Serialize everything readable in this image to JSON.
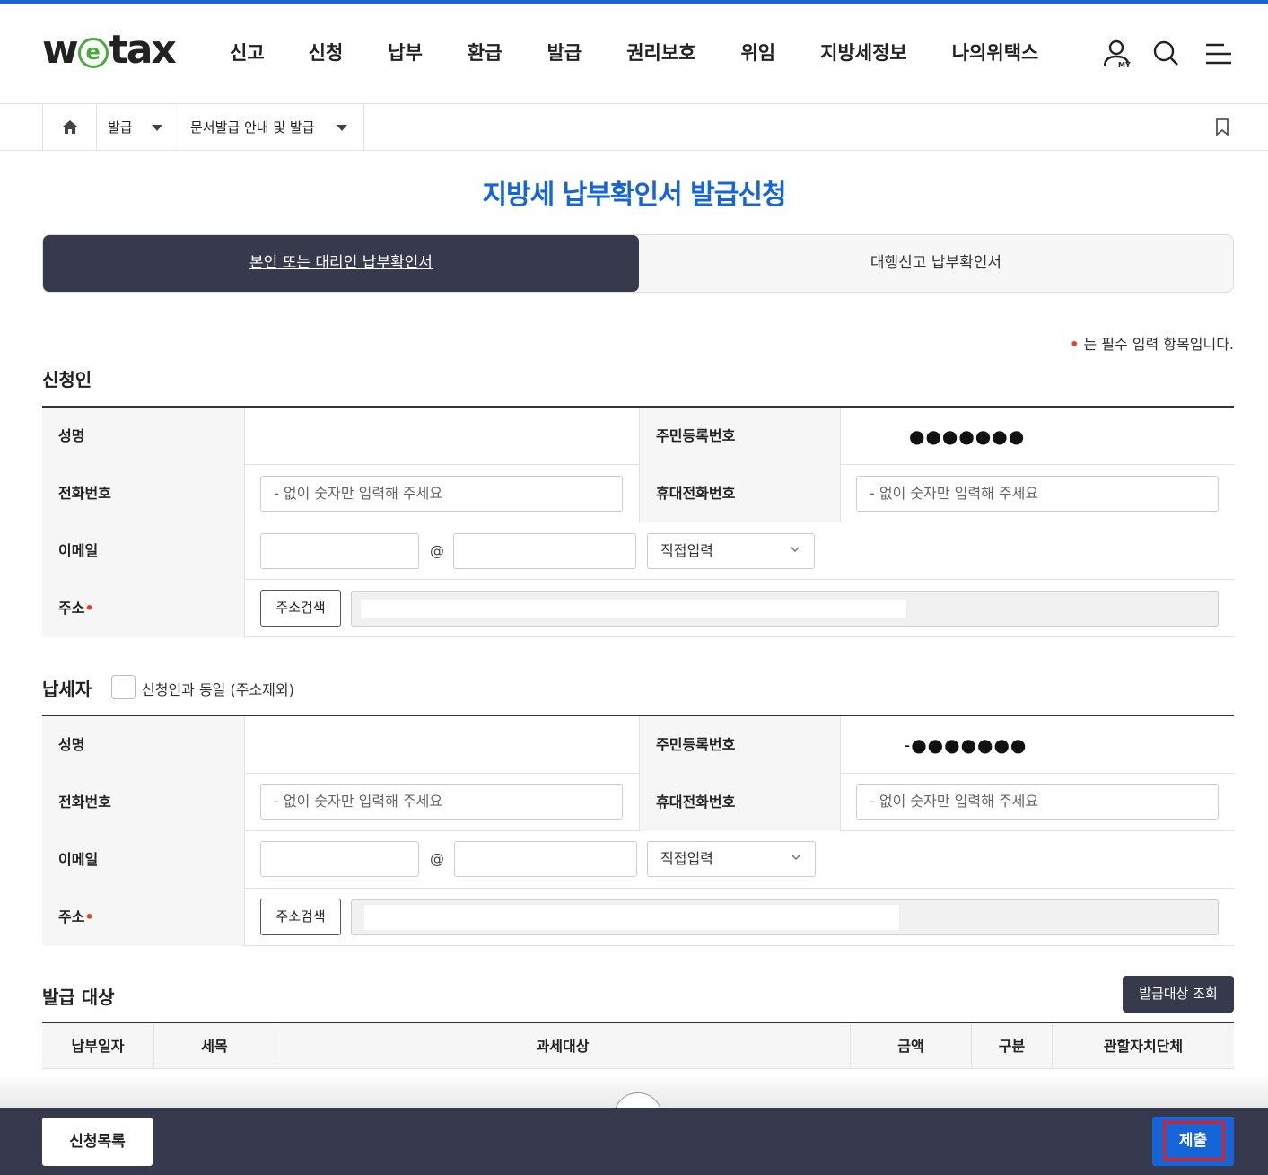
{
  "logo": {
    "pre": "w",
    "e": "e",
    "post": "tax"
  },
  "nav": [
    "신고",
    "신청",
    "납부",
    "환급",
    "발급",
    "권리보호",
    "위임",
    "지방세정보",
    "나의위택스"
  ],
  "header_icons": [
    "my-icon",
    "search-icon",
    "menu-icon"
  ],
  "breadcrumb": {
    "level1": "발급",
    "level2": "문서발급 안내 및 발급"
  },
  "page_title": "지방세 납부확인서 발급신청",
  "tabs": {
    "active": "본인 또는 대리인 납부확인서",
    "other": "대행신고 납부확인서"
  },
  "required_note": {
    "dot": "•",
    "text": "는 필수 입력 항목입니다."
  },
  "applicant": {
    "title": "신청인",
    "name_label": "성명",
    "rrn_label": "주민등록번호",
    "rrn_value": "●●●●●●●",
    "phone_label": "전화번호",
    "phone_placeholder": "- 없이 숫자만 입력해 주세요",
    "mobile_label": "휴대전화번호",
    "mobile_placeholder": "- 없이 숫자만 입력해 주세요",
    "email_label": "이메일",
    "at": "@",
    "email_domain_select": "직접입력",
    "address_label": "주소",
    "address_button": "주소검색"
  },
  "taxpayer": {
    "title": "납세자",
    "same_checkbox_label": "신청인과 동일 (주소제외)",
    "name_label": "성명",
    "rrn_label": "주민등록번호",
    "rrn_value": "-●●●●●●●",
    "phone_label": "전화번호",
    "phone_placeholder": "- 없이 숫자만 입력해 주세요",
    "mobile_label": "휴대전화번호",
    "mobile_placeholder": "- 없이 숫자만 입력해 주세요",
    "email_label": "이메일",
    "at": "@",
    "email_domain_select": "직접입력",
    "address_label": "주소",
    "address_button": "주소검색"
  },
  "issue_target": {
    "title": "발급 대상",
    "lookup_button": "발급대상 조회",
    "columns": [
      "납부일자",
      "세목",
      "과세대상",
      "금액",
      "구분",
      "관할자치단체"
    ]
  },
  "footer": {
    "list_button": "신청목록",
    "submit_button": "제출"
  }
}
